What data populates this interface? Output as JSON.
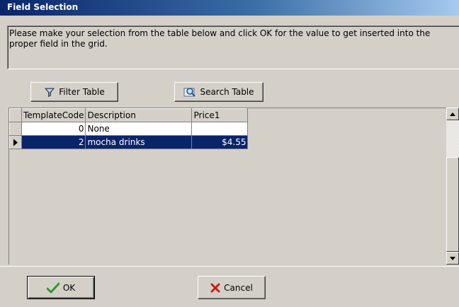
{
  "window": {
    "title": "Field Selection"
  },
  "instructions": "Please make your selection from the table below and click OK for the value to get inserted into the proper field in the grid.",
  "toolbar": {
    "filter_label": "Filter Table",
    "search_label": "Search Table"
  },
  "table": {
    "columns": [
      "TemplateCode",
      "Description",
      "Price1"
    ],
    "rows": [
      {
        "code": "0",
        "description": "None",
        "price": ""
      },
      {
        "code": "2",
        "description": "mocha drinks",
        "price": "$4.55"
      }
    ],
    "selected_row": 1
  },
  "footer": {
    "ok_label": "OK",
    "cancel_label": "Cancel"
  },
  "colors": {
    "titlebar": "#0a246a",
    "selection": "#0a246a",
    "ok_check": "#2e9a2e",
    "cancel_x": "#cc1a1a"
  }
}
